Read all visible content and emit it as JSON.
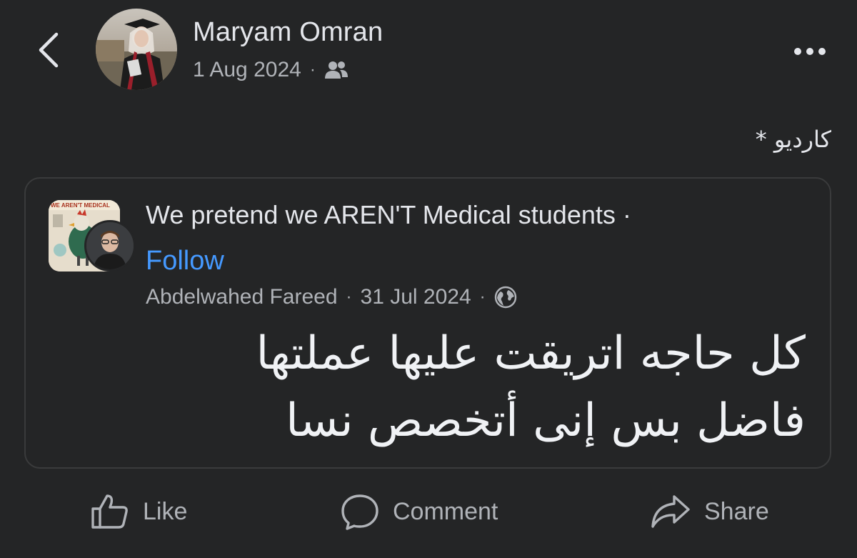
{
  "header": {
    "author_name": "Maryam Omran",
    "date": "1 Aug 2024",
    "separator": "·",
    "audience_icon": "friends-icon",
    "back_icon": "chevron-left-icon",
    "more_icon": "more-horizontal-icon"
  },
  "post": {
    "caption": "كارديو *"
  },
  "shared_post": {
    "group_name": "We pretend we AREN'T Medical students ·",
    "follow_label": "Follow",
    "group_avatar_text": "WE AREN'T MEDICAL",
    "author": "Abdelwahed Fareed",
    "separator": "·",
    "date": "31 Jul 2024",
    "privacy_icon": "globe-icon",
    "text_line_1": "كل حاجه اتريقت عليها عملتها",
    "text_line_2": "فاضل بس إنى أتخصص نسا"
  },
  "actions": {
    "like_label": "Like",
    "comment_label": "Comment",
    "share_label": "Share"
  },
  "colors": {
    "background": "#242526",
    "primary_text": "#e4e6eb",
    "secondary_text": "#b0b3b8",
    "link": "#4599ff",
    "card_border": "#3a3b3c"
  }
}
